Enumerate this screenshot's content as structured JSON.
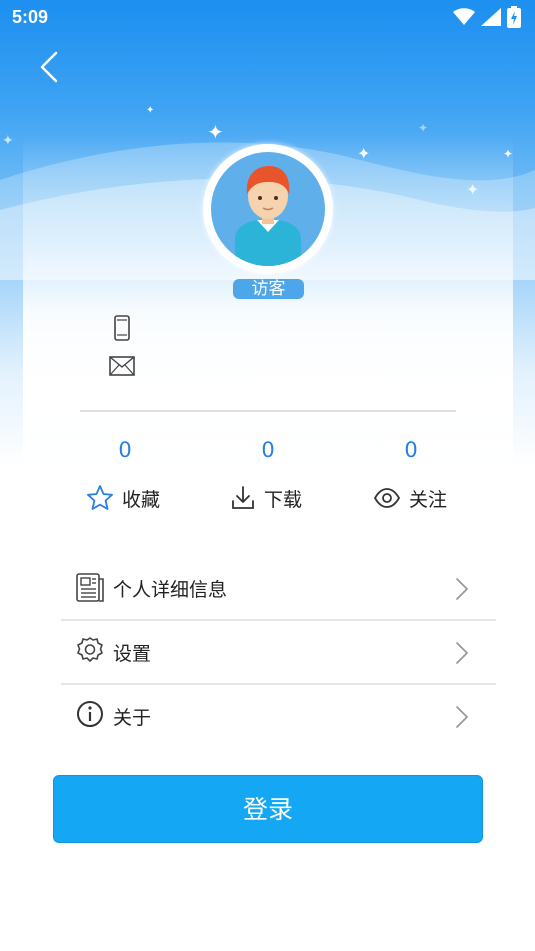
{
  "status_bar": {
    "time": "5:09"
  },
  "profile": {
    "guest_label": "访客"
  },
  "stats": [
    {
      "count": "0",
      "label": "收藏",
      "icon": "star-icon"
    },
    {
      "count": "0",
      "label": "下载",
      "icon": "download-icon"
    },
    {
      "count": "0",
      "label": "关注",
      "icon": "eye-icon"
    }
  ],
  "menu": [
    {
      "label": "个人详细信息",
      "icon": "profile-card-icon"
    },
    {
      "label": "设置",
      "icon": "gear-icon"
    },
    {
      "label": "关于",
      "icon": "info-icon"
    }
  ],
  "login": {
    "label": "登录"
  },
  "colors": {
    "primary": "#13a7f4",
    "stat_number": "#2a7fe0",
    "header_blue": "#1c8ff0"
  }
}
